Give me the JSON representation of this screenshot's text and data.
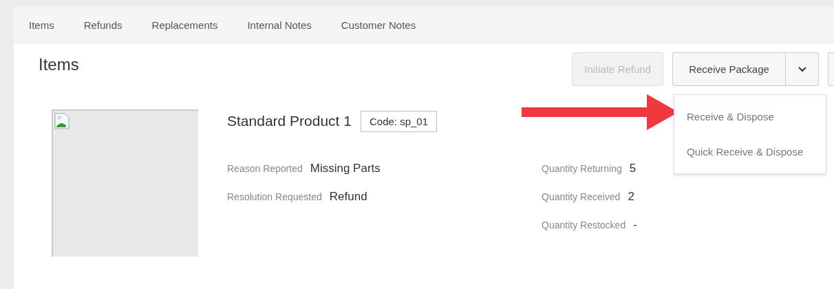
{
  "tabs": [
    {
      "label": "Items"
    },
    {
      "label": "Refunds"
    },
    {
      "label": "Replacements"
    },
    {
      "label": "Internal Notes"
    },
    {
      "label": "Customer Notes"
    }
  ],
  "section_title": "Items",
  "actions": [
    {
      "label": "Initiate Refund",
      "disabled": true
    },
    {
      "label": "Receive Package",
      "disabled": false
    }
  ],
  "dropdown_menu": [
    "Receive & Dispose",
    "Quick Receive & Dispose"
  ],
  "product": {
    "image": {
      "kind": "broken-image"
    },
    "name": "Standard Product 1",
    "code": "Code: sp_01",
    "details_left": [
      {
        "label": "Reason Reported",
        "value": "Missing Parts"
      },
      {
        "label": "Resolution Requested",
        "value": "Refund"
      }
    ],
    "details_right": [
      {
        "label": "Quantity Returning",
        "value": "5"
      },
      {
        "label": "Quantity Received",
        "value": "2"
      },
      {
        "label": "Quantity Restocked",
        "value": "-"
      }
    ]
  }
}
